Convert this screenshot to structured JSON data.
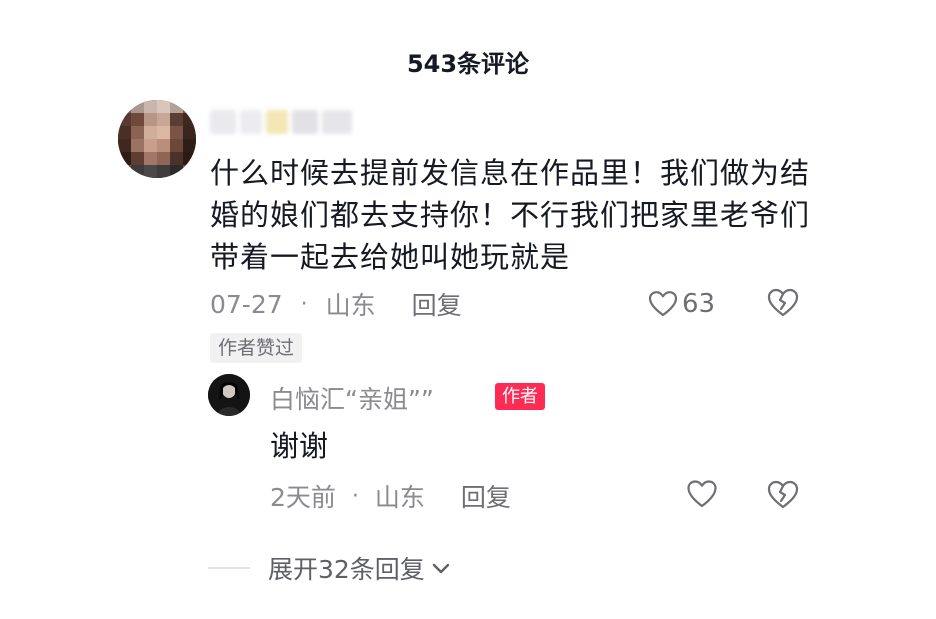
{
  "header": {
    "title": "543条评论"
  },
  "comment": {
    "text": "什么时候去提前发信息在作品里！我们做为结婚的娘们都去支持你！不行我们把家里老爷们带着一起去给她叫她玩就是",
    "date": "07-27",
    "separator": "·",
    "location": "山东",
    "reply_label": "回复",
    "like_count": "63",
    "author_liked_label": "作者赞过",
    "icons": {
      "like": "heart-outline-icon",
      "dislike": "broken-heart-icon"
    }
  },
  "reply": {
    "username": "白恼汇“亲姐””",
    "badge": "作者",
    "text": "谢谢",
    "date": "2天前",
    "separator": "·",
    "location": "山东",
    "reply_label": "回复",
    "icons": {
      "like": "heart-outline-icon",
      "dislike": "broken-heart-icon"
    }
  },
  "expand": {
    "label": "展开32条回复",
    "icon": "chevron-down-icon"
  },
  "colors": {
    "text_primary": "#161823",
    "text_secondary": "#8a8b91",
    "badge_red": "#fe2c55",
    "tag_bg": "#f1f1f2"
  }
}
